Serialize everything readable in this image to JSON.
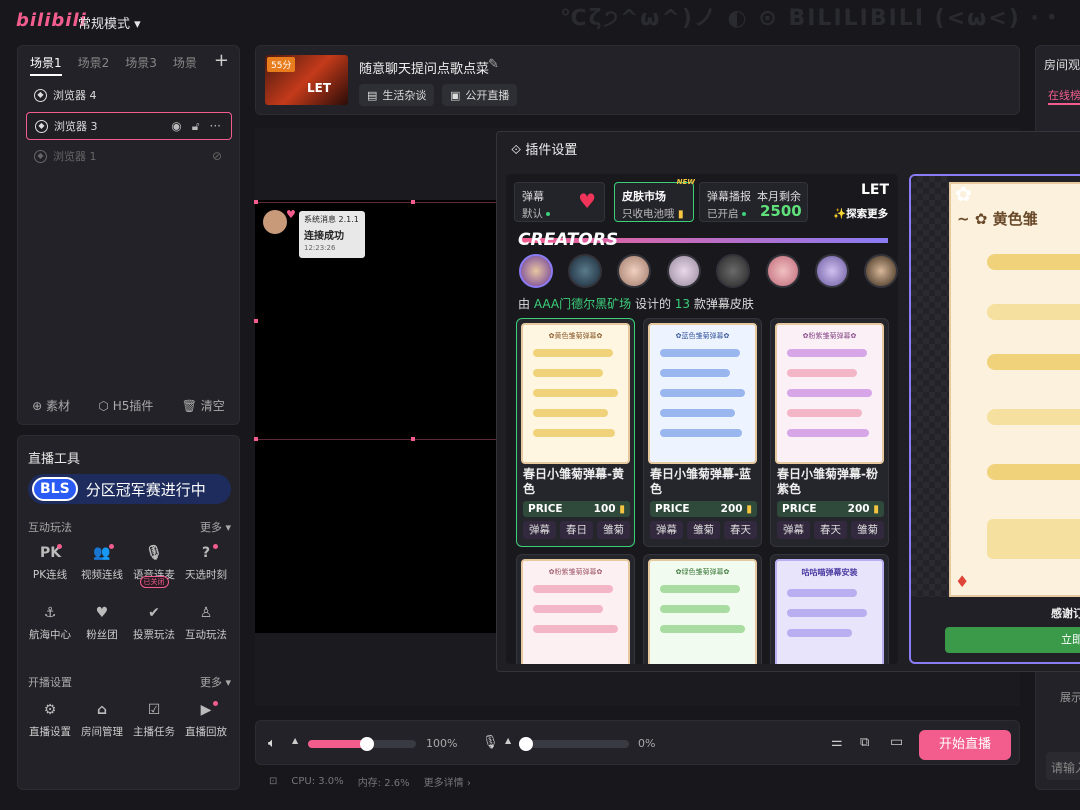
{
  "topbar": {
    "logo": "bilibili",
    "mode": "常规模式 ▾",
    "watermark": "℃ζ੭^ω^)ノ ◐ ⊙ BILILIBILI   (<ω<) ·・ ヽ(ˋ∀ˊ)ﾉ"
  },
  "scenes": {
    "tabs": [
      "场景1",
      "场景2",
      "场景3",
      "场景"
    ],
    "add": "+",
    "sources": [
      {
        "label": "浏览器 4"
      },
      {
        "label": "浏览器 3"
      },
      {
        "label": "浏览器 1"
      }
    ],
    "footer": {
      "material": "⊕ 素材",
      "h5": "⬡ H5插件",
      "clear": "🗑 清空"
    }
  },
  "tools": {
    "title": "直播工具",
    "banner": {
      "logo": "BLS",
      "text": "分区冠军赛进行中"
    },
    "interactive": {
      "label": "互动玩法",
      "more": "更多 ▾",
      "items": [
        {
          "icon": "PK",
          "label": "PK连线"
        },
        {
          "icon": "👥",
          "label": "视频连线"
        },
        {
          "icon": "🎙",
          "label": "语音连麦",
          "tag": "已关闭"
        },
        {
          "icon": "?",
          "label": "天选时刻"
        },
        {
          "icon": "⚓",
          "label": "航海中心"
        },
        {
          "icon": "♥",
          "label": "粉丝团"
        },
        {
          "icon": "✔",
          "label": "投票玩法"
        },
        {
          "icon": "♙",
          "label": "互动玩法"
        }
      ]
    },
    "settings": {
      "label": "开播设置",
      "more": "更多 ▾",
      "items": [
        {
          "icon": "⚙",
          "label": "直播设置"
        },
        {
          "icon": "⌂",
          "label": "房间管理"
        },
        {
          "icon": "☑",
          "label": "主播任务"
        },
        {
          "icon": "▶",
          "label": "直播回放"
        }
      ]
    }
  },
  "room": {
    "badge": "55分",
    "thumb_text": "LET",
    "title": "随意聊天提问点歌点菜",
    "chips": [
      "生活杂谈",
      "公开直播"
    ]
  },
  "toast": {
    "l1": "系统消息 2.1.1",
    "l2": "连接成功",
    "l3": "12:23:26"
  },
  "bottom": {
    "volume": "100%",
    "mic": "0%",
    "golive": "开始直播",
    "volume_level": 1.0,
    "mic_level": 0.0
  },
  "status": {
    "cpu": "CPU: 3.0%",
    "mem": "内存: 2.6%",
    "more": "更多详情 ›"
  },
  "right": {
    "title": "房间观",
    "tab": "在线榜",
    "show": "展示",
    "input": "请输入"
  },
  "dialog": {
    "title": "插件设置",
    "switches": [
      {
        "t": "弹幕",
        "s": "默认"
      },
      {
        "t": "皮肤市场",
        "s": "只收电池哦",
        "badge": "NEW"
      },
      {
        "t": "弹幕播报",
        "s": "已开启"
      }
    ],
    "remain_label": "本月剩余",
    "remain": "2500",
    "brand": "LET",
    "explore": "✨探索更多",
    "creators": "CREATORS",
    "designer": {
      "pre": "由 ",
      "name": "AAA门德尔黑矿场",
      "mid": " 设计的 ",
      "count": "13",
      "post": " 款弹幕皮肤"
    },
    "cards": [
      {
        "thumb": "✿黄色雏菊弹幕✿",
        "name": "春日小雏菊弹幕-黄色",
        "price_label": "PRICE",
        "price": "100",
        "tags": [
          "弹幕",
          "春日",
          "雏菊"
        ],
        "color": "#f0d27a"
      },
      {
        "thumb": "✿蓝色雏菊弹幕✿",
        "name": "春日小雏菊弹幕-蓝色",
        "price_label": "PRICE",
        "price": "200",
        "tags": [
          "弹幕",
          "雏菊",
          "春天"
        ],
        "color": "#9ab6ef"
      },
      {
        "thumb": "✿粉紫雏菊弹幕✿",
        "name": "春日小雏菊弹幕-粉紫色",
        "price_label": "PRICE",
        "price": "200",
        "tags": [
          "弹幕",
          "春天",
          "雏菊"
        ],
        "color": "#d7a6e8"
      },
      {
        "thumb": "✿粉紫雏菊弹幕✿",
        "color": "#f3b6c6"
      },
      {
        "thumb": "✿绿色雏菊弹幕✿",
        "color": "#a8dca0"
      },
      {
        "thumb": "咕咕喵弹幕安装",
        "color": "#b8aef0"
      }
    ],
    "preview": {
      "title": "~ ✿ 黄色雏",
      "thanks": "感谢订",
      "btn": "立即"
    }
  }
}
